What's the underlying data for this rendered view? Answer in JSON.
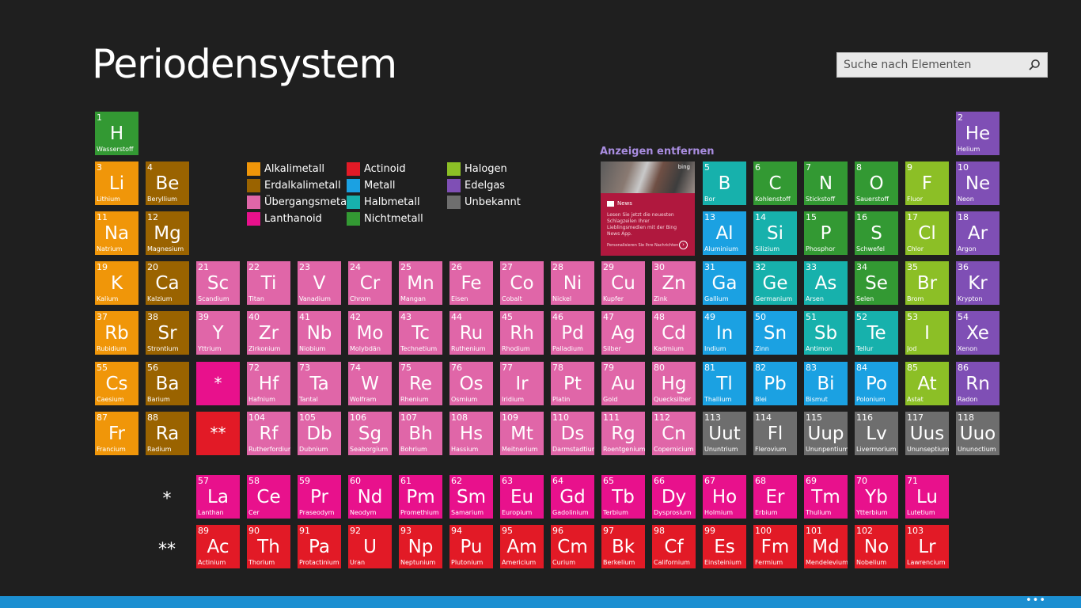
{
  "app": {
    "title": "Periodensystem"
  },
  "search": {
    "placeholder": "Suche nach Elementen",
    "icon": "search-icon"
  },
  "ad": {
    "label": "Anzeigen entfernen",
    "brand": "bing",
    "app": "News",
    "text": "Lesen Sie jetzt die neuesten Schlagzeilen Ihrer Lieblingsmedien mit der Bing News App.",
    "cta": "Personalisieren Sie Ihre Nachrichten"
  },
  "colors": {
    "alkali": "#f09609",
    "erdalkali": "#9a6300",
    "uebergang": "#e066a8",
    "lanthanoid": "#e8118c",
    "actinoid": "#e21a26",
    "metall": "#1ba1e2",
    "halbmetall": "#17b1ac",
    "nichtmetall": "#339933",
    "halogen": "#8cbf26",
    "edelgas": "#7f4fb5",
    "unbekannt": "#6e6e6e"
  },
  "legend": [
    {
      "key": "alkali",
      "label": "Alkalimetall"
    },
    {
      "key": "erdalkali",
      "label": "Erdalkalimetall"
    },
    {
      "key": "uebergang",
      "label": "Übergangsmetall"
    },
    {
      "key": "lanthanoid",
      "label": "Lanthanoid"
    },
    {
      "key": "actinoid",
      "label": "Actinoid"
    },
    {
      "key": "metall",
      "label": "Metall"
    },
    {
      "key": "halbmetall",
      "label": "Halbmetall"
    },
    {
      "key": "nichtmetall",
      "label": "Nichtmetall"
    },
    {
      "key": "halogen",
      "label": "Halogen"
    },
    {
      "key": "edelgas",
      "label": "Edelgas"
    },
    {
      "key": "unbekannt",
      "label": "Unbekannt"
    }
  ],
  "markers": {
    "lanthanoid": "*",
    "actinoid": "**"
  },
  "elements": [
    [
      "1",
      "H",
      "Wasserstoff",
      "nichtmetall"
    ],
    [
      "2",
      "He",
      "Helium",
      "edelgas"
    ],
    [
      "3",
      "Li",
      "Lithium",
      "alkali"
    ],
    [
      "4",
      "Be",
      "Beryllium",
      "erdalkali"
    ],
    [
      "5",
      "B",
      "Bor",
      "halbmetall"
    ],
    [
      "6",
      "C",
      "Kohlenstoff",
      "nichtmetall"
    ],
    [
      "7",
      "N",
      "Stickstoff",
      "nichtmetall"
    ],
    [
      "8",
      "O",
      "Sauerstoff",
      "nichtmetall"
    ],
    [
      "9",
      "F",
      "Fluor",
      "halogen"
    ],
    [
      "10",
      "Ne",
      "Neon",
      "edelgas"
    ],
    [
      "11",
      "Na",
      "Natrium",
      "alkali"
    ],
    [
      "12",
      "Mg",
      "Magnesium",
      "erdalkali"
    ],
    [
      "13",
      "Al",
      "Aluminium",
      "metall"
    ],
    [
      "14",
      "Si",
      "Silizium",
      "halbmetall"
    ],
    [
      "15",
      "P",
      "Phosphor",
      "nichtmetall"
    ],
    [
      "16",
      "S",
      "Schwefel",
      "nichtmetall"
    ],
    [
      "17",
      "Cl",
      "Chlor",
      "halogen"
    ],
    [
      "18",
      "Ar",
      "Argon",
      "edelgas"
    ],
    [
      "19",
      "K",
      "Kalium",
      "alkali"
    ],
    [
      "20",
      "Ca",
      "Kalzium",
      "erdalkali"
    ],
    [
      "21",
      "Sc",
      "Scandium",
      "uebergang"
    ],
    [
      "22",
      "Ti",
      "Titan",
      "uebergang"
    ],
    [
      "23",
      "V",
      "Vanadium",
      "uebergang"
    ],
    [
      "24",
      "Cr",
      "Chrom",
      "uebergang"
    ],
    [
      "25",
      "Mn",
      "Mangan",
      "uebergang"
    ],
    [
      "26",
      "Fe",
      "Eisen",
      "uebergang"
    ],
    [
      "27",
      "Co",
      "Cobalt",
      "uebergang"
    ],
    [
      "28",
      "Ni",
      "Nickel",
      "uebergang"
    ],
    [
      "29",
      "Cu",
      "Kupfer",
      "uebergang"
    ],
    [
      "30",
      "Zn",
      "Zink",
      "uebergang"
    ],
    [
      "31",
      "Ga",
      "Gallium",
      "metall"
    ],
    [
      "32",
      "Ge",
      "Germanium",
      "halbmetall"
    ],
    [
      "33",
      "As",
      "Arsen",
      "halbmetall"
    ],
    [
      "34",
      "Se",
      "Selen",
      "nichtmetall"
    ],
    [
      "35",
      "Br",
      "Brom",
      "halogen"
    ],
    [
      "36",
      "Kr",
      "Krypton",
      "edelgas"
    ],
    [
      "37",
      "Rb",
      "Rubidium",
      "alkali"
    ],
    [
      "38",
      "Sr",
      "Strontium",
      "erdalkali"
    ],
    [
      "39",
      "Y",
      "Yttrium",
      "uebergang"
    ],
    [
      "40",
      "Zr",
      "Zirkonium",
      "uebergang"
    ],
    [
      "41",
      "Nb",
      "Niobium",
      "uebergang"
    ],
    [
      "42",
      "Mo",
      "Molybdän",
      "uebergang"
    ],
    [
      "43",
      "Tc",
      "Technetium",
      "uebergang"
    ],
    [
      "44",
      "Ru",
      "Ruthenium",
      "uebergang"
    ],
    [
      "45",
      "Rh",
      "Rhodium",
      "uebergang"
    ],
    [
      "46",
      "Pd",
      "Palladium",
      "uebergang"
    ],
    [
      "47",
      "Ag",
      "Silber",
      "uebergang"
    ],
    [
      "48",
      "Cd",
      "Kadmium",
      "uebergang"
    ],
    [
      "49",
      "In",
      "Indium",
      "metall"
    ],
    [
      "50",
      "Sn",
      "Zinn",
      "metall"
    ],
    [
      "51",
      "Sb",
      "Antimon",
      "halbmetall"
    ],
    [
      "52",
      "Te",
      "Tellur",
      "halbmetall"
    ],
    [
      "53",
      "I",
      "Jod",
      "halogen"
    ],
    [
      "54",
      "Xe",
      "Xenon",
      "edelgas"
    ],
    [
      "55",
      "Cs",
      "Caesium",
      "alkali"
    ],
    [
      "56",
      "Ba",
      "Barium",
      "erdalkali"
    ],
    [
      "72",
      "Hf",
      "Hafnium",
      "uebergang"
    ],
    [
      "73",
      "Ta",
      "Tantal",
      "uebergang"
    ],
    [
      "74",
      "W",
      "Wolfram",
      "uebergang"
    ],
    [
      "75",
      "Re",
      "Rhenium",
      "uebergang"
    ],
    [
      "76",
      "Os",
      "Osmium",
      "uebergang"
    ],
    [
      "77",
      "Ir",
      "Iridium",
      "uebergang"
    ],
    [
      "78",
      "Pt",
      "Platin",
      "uebergang"
    ],
    [
      "79",
      "Au",
      "Gold",
      "uebergang"
    ],
    [
      "80",
      "Hg",
      "Quecksilber",
      "uebergang"
    ],
    [
      "81",
      "Tl",
      "Thallium",
      "metall"
    ],
    [
      "82",
      "Pb",
      "Blei",
      "metall"
    ],
    [
      "83",
      "Bi",
      "Bismut",
      "metall"
    ],
    [
      "84",
      "Po",
      "Polonium",
      "metall"
    ],
    [
      "85",
      "At",
      "Astat",
      "halogen"
    ],
    [
      "86",
      "Rn",
      "Radon",
      "edelgas"
    ],
    [
      "87",
      "Fr",
      "Francium",
      "alkali"
    ],
    [
      "88",
      "Ra",
      "Radium",
      "erdalkali"
    ],
    [
      "104",
      "Rf",
      "Rutherfordium",
      "uebergang"
    ],
    [
      "105",
      "Db",
      "Dubnium",
      "uebergang"
    ],
    [
      "106",
      "Sg",
      "Seaborgium",
      "uebergang"
    ],
    [
      "107",
      "Bh",
      "Bohrium",
      "uebergang"
    ],
    [
      "108",
      "Hs",
      "Hassium",
      "uebergang"
    ],
    [
      "109",
      "Mt",
      "Meitnerium",
      "uebergang"
    ],
    [
      "110",
      "Ds",
      "Darmstadtium",
      "uebergang"
    ],
    [
      "111",
      "Rg",
      "Roentgenium",
      "uebergang"
    ],
    [
      "112",
      "Cn",
      "Copernicium",
      "uebergang"
    ],
    [
      "113",
      "Uut",
      "Ununtrium",
      "unbekannt"
    ],
    [
      "114",
      "Fl",
      "Flerovium",
      "unbekannt"
    ],
    [
      "115",
      "Uup",
      "Ununpentium",
      "unbekannt"
    ],
    [
      "116",
      "Lv",
      "Livermorium",
      "unbekannt"
    ],
    [
      "117",
      "Uus",
      "Ununseptium",
      "unbekannt"
    ],
    [
      "118",
      "Uuo",
      "Ununoctium",
      "unbekannt"
    ],
    [
      "57",
      "La",
      "Lanthan",
      "lanthanoid"
    ],
    [
      "58",
      "Ce",
      "Cer",
      "lanthanoid"
    ],
    [
      "59",
      "Pr",
      "Praseodym",
      "lanthanoid"
    ],
    [
      "60",
      "Nd",
      "Neodym",
      "lanthanoid"
    ],
    [
      "61",
      "Pm",
      "Promethium",
      "lanthanoid"
    ],
    [
      "62",
      "Sm",
      "Samarium",
      "lanthanoid"
    ],
    [
      "63",
      "Eu",
      "Europium",
      "lanthanoid"
    ],
    [
      "64",
      "Gd",
      "Gadolinium",
      "lanthanoid"
    ],
    [
      "65",
      "Tb",
      "Terbium",
      "lanthanoid"
    ],
    [
      "66",
      "Dy",
      "Dysprosium",
      "lanthanoid"
    ],
    [
      "67",
      "Ho",
      "Holmium",
      "lanthanoid"
    ],
    [
      "68",
      "Er",
      "Erbium",
      "lanthanoid"
    ],
    [
      "69",
      "Tm",
      "Thulium",
      "lanthanoid"
    ],
    [
      "70",
      "Yb",
      "Ytterbium",
      "lanthanoid"
    ],
    [
      "71",
      "Lu",
      "Lutetium",
      "lanthanoid"
    ],
    [
      "89",
      "Ac",
      "Actinium",
      "actinoid"
    ],
    [
      "90",
      "Th",
      "Thorium",
      "actinoid"
    ],
    [
      "91",
      "Pa",
      "Protactinium",
      "actinoid"
    ],
    [
      "92",
      "U",
      "Uran",
      "actinoid"
    ],
    [
      "93",
      "Np",
      "Neptunium",
      "actinoid"
    ],
    [
      "94",
      "Pu",
      "Plutonium",
      "actinoid"
    ],
    [
      "95",
      "Am",
      "Americium",
      "actinoid"
    ],
    [
      "96",
      "Cm",
      "Curium",
      "actinoid"
    ],
    [
      "97",
      "Bk",
      "Berkelium",
      "actinoid"
    ],
    [
      "98",
      "Cf",
      "Californium",
      "actinoid"
    ],
    [
      "99",
      "Es",
      "Einsteinium",
      "actinoid"
    ],
    [
      "100",
      "Fm",
      "Fermium",
      "actinoid"
    ],
    [
      "101",
      "Md",
      "Mendelevium",
      "actinoid"
    ],
    [
      "102",
      "No",
      "Nobelium",
      "actinoid"
    ],
    [
      "103",
      "Lr",
      "Lawrencium",
      "actinoid"
    ]
  ],
  "appbar": {
    "more": "•••"
  }
}
